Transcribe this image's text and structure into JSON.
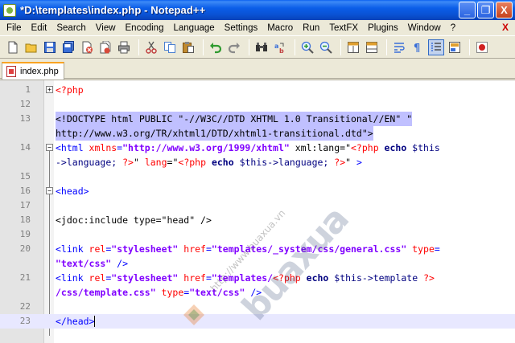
{
  "window": {
    "title": "*D:\\templates\\index.php - Notepad++",
    "min_label": "_",
    "max_label": "❐",
    "close_label": "X"
  },
  "menu": {
    "items": [
      "File",
      "Edit",
      "Search",
      "View",
      "Encoding",
      "Language",
      "Settings",
      "Macro",
      "Run",
      "TextFX",
      "Plugins",
      "Window",
      "?"
    ],
    "close_label": "X"
  },
  "toolbar": {
    "icons": [
      {
        "name": "new-file-icon",
        "color": "#ffffff"
      },
      {
        "name": "open-file-icon",
        "color": "#f4c542"
      },
      {
        "name": "save-icon",
        "color": "#3a6fd8"
      },
      {
        "name": "save-all-icon",
        "color": "#3a6fd8"
      },
      {
        "name": "close-icon",
        "color": "#d84a3a"
      },
      {
        "name": "close-all-icon",
        "color": "#d84a3a"
      },
      {
        "name": "print-icon",
        "color": "#7f7f7f"
      },
      {
        "name": "cut-icon",
        "color": "#c04040"
      },
      {
        "name": "copy-icon",
        "color": "#4a7fd0"
      },
      {
        "name": "paste-icon",
        "color": "#c08a30"
      },
      {
        "name": "undo-icon",
        "color": "#2f9a2f"
      },
      {
        "name": "redo-icon",
        "color": "#7f7f7f"
      },
      {
        "name": "find-icon",
        "color": "#404040"
      },
      {
        "name": "replace-icon",
        "color": "#3a6fd8"
      },
      {
        "name": "zoom-in-icon",
        "color": "#3aa03a"
      },
      {
        "name": "zoom-out-icon",
        "color": "#3aa03a"
      },
      {
        "name": "sync-v-icon",
        "color": "#e0a030"
      },
      {
        "name": "sync-h-icon",
        "color": "#e0a030"
      },
      {
        "name": "word-wrap-icon",
        "color": "#3a6fd8"
      },
      {
        "name": "show-all-chars-icon",
        "color": "#3a6fd8"
      },
      {
        "name": "indent-guide-icon",
        "color": "#3a6fd8"
      },
      {
        "name": "user-lang-icon",
        "color": "#e0a030"
      },
      {
        "name": "record-macro-icon",
        "color": "#d02020"
      }
    ]
  },
  "tabs": [
    {
      "label": "index.php"
    }
  ],
  "editor": {
    "lines": [
      {
        "num": "1",
        "fold": "plus"
      },
      {
        "num": "12",
        "fold": "none"
      },
      {
        "num": "13",
        "fold": "none"
      },
      {
        "num": "",
        "fold": "none"
      },
      {
        "num": "14",
        "fold": "minus"
      },
      {
        "num": "",
        "fold": "none"
      },
      {
        "num": "15",
        "fold": "none"
      },
      {
        "num": "16",
        "fold": "minus"
      },
      {
        "num": "17",
        "fold": "none"
      },
      {
        "num": "18",
        "fold": "none"
      },
      {
        "num": "19",
        "fold": "none"
      },
      {
        "num": "20",
        "fold": "none"
      },
      {
        "num": "",
        "fold": "none"
      },
      {
        "num": "21",
        "fold": "none"
      },
      {
        "num": "",
        "fold": "none"
      },
      {
        "num": "22",
        "fold": "none"
      },
      {
        "num": "23",
        "fold": "none"
      }
    ],
    "code": {
      "l1": "<?php",
      "l13a_1": "<!DOCTYPE html PUBLIC \"",
      "l13a_2": "-//W3C//DTD XHTML 1.0 Transitional//EN",
      "l13a_3": "\" \"",
      "l13b_1": "http://www.w3.org/TR/xhtml1/DTD/xhtml1-transitional.dtd",
      "l13b_2": "\">",
      "l14a_1": "<html",
      "l14a_2": " xmlns",
      "l14a_3": "=",
      "l14a_4": "\"http://www.w3.org/1999/xhtml\"",
      "l14a_5": " xml:lang",
      "l14a_6": "=\"",
      "l14a_7": "<?php",
      "l14a_8": " echo",
      "l14a_9": " $this",
      "l14b_1": "->",
      "l14b_2": "language; ",
      "l14b_3": "?>",
      "l14b_4": "\"",
      "l14b_5": " lang",
      "l14b_6": "=\"",
      "l14b_7": "<?php",
      "l14b_8": " echo",
      "l14b_9": " $this",
      "l14b_10": "->",
      "l14b_11": "language; ",
      "l14b_12": "?>",
      "l14b_13": "\"",
      "l14b_14": " >",
      "l16": "<head>",
      "l18_1": "<jdoc:include type=\"",
      "l18_2": "head",
      "l18_3": "\" />",
      "l20a_1": "<link",
      "l20a_2": " rel",
      "l20a_3": "=",
      "l20a_4": "\"stylesheet\"",
      "l20a_5": " href",
      "l20a_6": "=",
      "l20a_7": "\"templates/_system/css/general.css\"",
      "l20a_8": " type",
      "l20a_9": "=",
      "l20b_1": "\"text/css\"",
      "l20b_2": " />",
      "l21a_1": "<link",
      "l21a_2": " rel",
      "l21a_3": "=",
      "l21a_4": "\"stylesheet\"",
      "l21a_5": " href",
      "l21a_6": "=",
      "l21a_7": "\"templates/",
      "l21a_8": "<?php",
      "l21a_9": " echo",
      "l21a_10": " $this",
      "l21a_11": "->",
      "l21a_12": "template ",
      "l21a_13": "?>",
      "l21b_1": "/css/template.css\"",
      "l21b_2": " type",
      "l21b_3": "=",
      "l21b_4": "\"text/css\"",
      "l21b_5": " />",
      "l23_1": "</head",
      "l23_2": ">"
    }
  },
  "watermark": {
    "brand": "buaxua",
    "url": "http://www.buaxua.vn"
  }
}
